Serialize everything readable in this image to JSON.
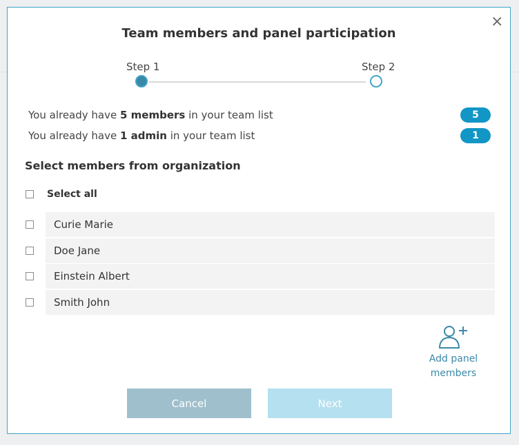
{
  "modal": {
    "title": "Team members and panel participation",
    "close": "×",
    "steps": [
      "Step 1",
      "Step 2"
    ],
    "active_step": 1,
    "info": [
      {
        "prefix": "You already have ",
        "strong": "5 members",
        "suffix": " in your team list",
        "badge": "5"
      },
      {
        "prefix": "You already have ",
        "strong": "1 admin",
        "suffix": " in your team list",
        "badge": "1"
      }
    ],
    "section_title": "Select members from organization",
    "select_all": "Select all",
    "members": [
      "Curie Marie",
      "Doe Jane",
      "Einstein Albert",
      "Smith John"
    ],
    "add_panel": {
      "label_line1": "Add panel",
      "label_line2": "members",
      "icon": "add-user-icon"
    },
    "buttons": {
      "cancel": "Cancel",
      "next": "Next"
    }
  },
  "colors": {
    "accent": "#1196c6",
    "border": "#3fa4c8",
    "cancel_bg": "#9fbfcc",
    "next_bg": "#b5e0ef"
  }
}
